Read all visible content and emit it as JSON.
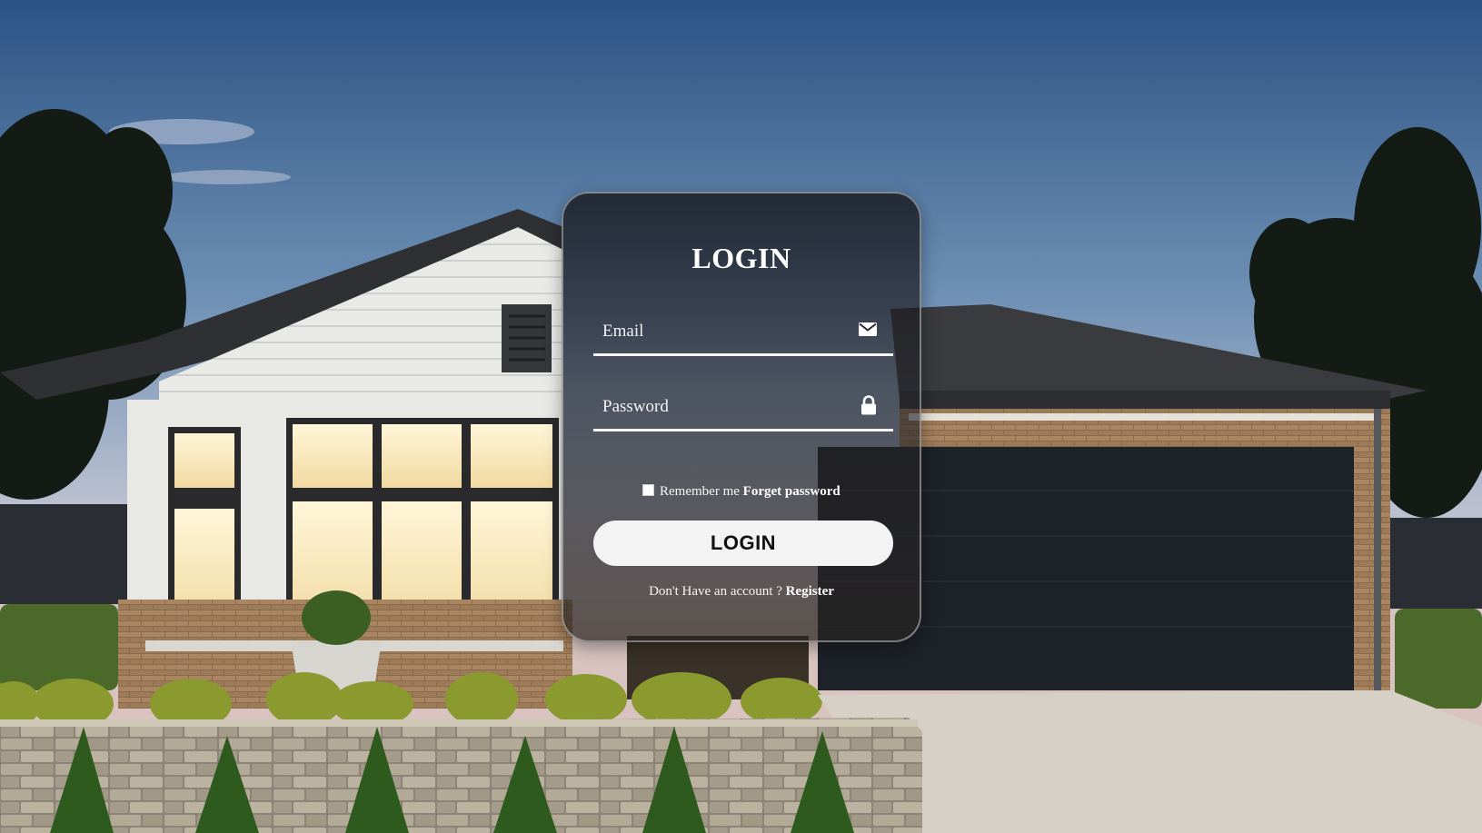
{
  "login": {
    "title": "LOGIN",
    "email_placeholder": "Email",
    "email_icon": "envelope-icon",
    "password_placeholder": "Password",
    "password_icon": "lock-icon",
    "remember_label": "Remember me",
    "forget_link": "Forget password",
    "button_label": "LOGIN",
    "register_prompt": "Don't Have an account ?",
    "register_link": "Register"
  },
  "colors": {
    "card_background": "#1e1e22",
    "card_border": "#c8c8c8",
    "button_background": "#f3f3f3",
    "button_text": "#111111",
    "text": "#ffffff"
  }
}
